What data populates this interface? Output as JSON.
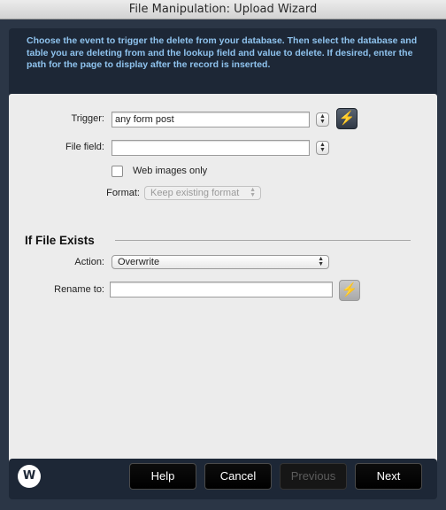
{
  "window": {
    "title": "File Manipulation: Upload Wizard"
  },
  "instructions": "Choose the event to trigger the delete from your database. Then select the database and table you are deleting from and the lookup field and value to delete. If desired, enter the path for the page to display after the record is inserted.",
  "form": {
    "trigger_label": "Trigger:",
    "trigger_value": "any form post",
    "file_field_label": "File field:",
    "file_field_value": "",
    "web_images_only_label": "Web images only",
    "web_images_only_checked": false,
    "format_label": "Format:",
    "format_value": "Keep existing format"
  },
  "if_file_exists": {
    "title": "If File Exists",
    "action_label": "Action:",
    "action_value": "Overwrite",
    "rename_label": "Rename to:",
    "rename_value": ""
  },
  "footer": {
    "logo_text": "W",
    "help": "Help",
    "cancel": "Cancel",
    "previous": "Previous",
    "next": "Next"
  },
  "icons": {
    "bolt": "lightning-bolt-icon",
    "stepper": "up-down-arrows-icon"
  },
  "colors": {
    "instruction_text": "#8fc3ee",
    "frame": "#2b3646",
    "bolt_active": "#ffcc00"
  }
}
